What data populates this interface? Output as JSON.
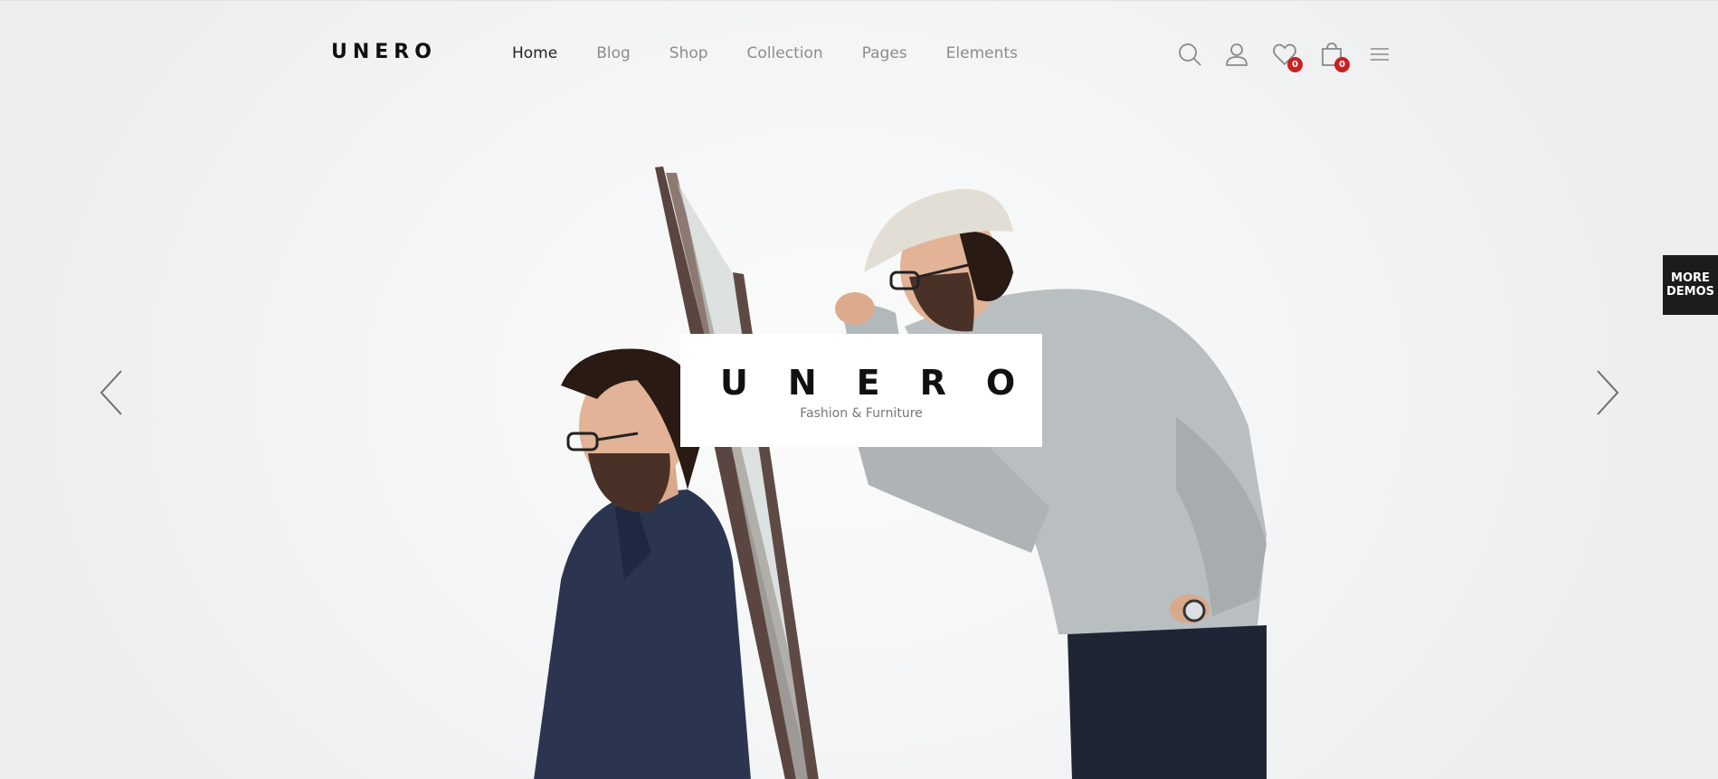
{
  "brand": {
    "logo_text": "UNERO"
  },
  "nav": {
    "items": [
      {
        "label": "Home",
        "active": true
      },
      {
        "label": "Blog",
        "active": false
      },
      {
        "label": "Shop",
        "active": false
      },
      {
        "label": "Collection",
        "active": false
      },
      {
        "label": "Pages",
        "active": false
      },
      {
        "label": "Elements",
        "active": false
      }
    ]
  },
  "header_icons": {
    "search": "search-icon",
    "account": "user-icon",
    "wishlist": "heart-icon",
    "wishlist_count": "0",
    "cart": "shopping-bag-icon",
    "cart_count": "0",
    "menu": "hamburger-menu-icon"
  },
  "hero": {
    "title": "UNERO",
    "subtitle": "Fashion & Furniture",
    "prev_icon": "chevron-left-icon",
    "next_icon": "chevron-right-icon"
  },
  "side_tab": {
    "line1": "MORE",
    "line2": "DEMOS"
  },
  "colors": {
    "accent_badge": "#cc1f1f",
    "text_dark": "#111111",
    "text_muted": "#8c8c8c",
    "side_tab_bg": "#1c1c1c"
  }
}
